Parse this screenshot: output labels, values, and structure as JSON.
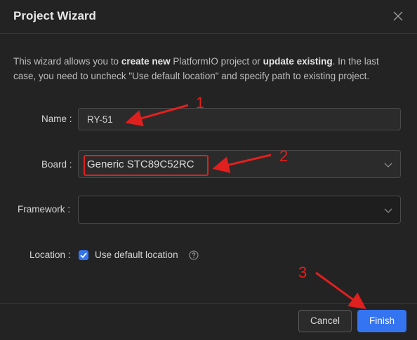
{
  "dialog": {
    "title": "Project Wizard",
    "description": {
      "part1": "This wizard allows you to ",
      "bold1": "create new",
      "part2": " PlatformIO project or ",
      "bold2": "update existing",
      "part3": ". In the last case, you need to uncheck \"Use default location\" and specify path to existing project."
    },
    "close_icon": "close-icon"
  },
  "form": {
    "name_label": "Name",
    "name_value": "RY-51",
    "board_label": "Board",
    "board_value": "Generic STC89C52RC",
    "framework_label": "Framework",
    "framework_value": "",
    "location_label": "Location",
    "use_default_location_label": "Use default location",
    "use_default_location_checked": true
  },
  "buttons": {
    "cancel": "Cancel",
    "finish": "Finish"
  },
  "annotations": {
    "one": "1",
    "two": "2",
    "three": "3",
    "color": "#e0201f"
  },
  "colors": {
    "background": "#232323",
    "accent": "#3574f0"
  }
}
